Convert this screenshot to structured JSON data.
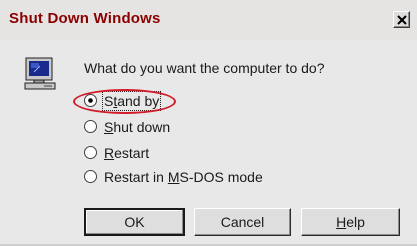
{
  "window": {
    "title": "Shut Down Windows",
    "close_icon": "close-icon"
  },
  "prompt": "What do you want the computer to do?",
  "options": [
    {
      "label": "Stand by",
      "selected": true
    },
    {
      "label": "Shut down",
      "selected": false
    },
    {
      "label": "Restart",
      "selected": false
    },
    {
      "label": "Restart in MS-DOS mode",
      "selected": false
    }
  ],
  "buttons": {
    "ok": "OK",
    "cancel": "Cancel",
    "help": "Help"
  },
  "icons": {
    "computer": "computer-monitor-icon"
  },
  "colors": {
    "title_text": "#8a0000",
    "dialog_bg": "#e9e8e8",
    "highlight_ellipse": "#d21c2a"
  }
}
